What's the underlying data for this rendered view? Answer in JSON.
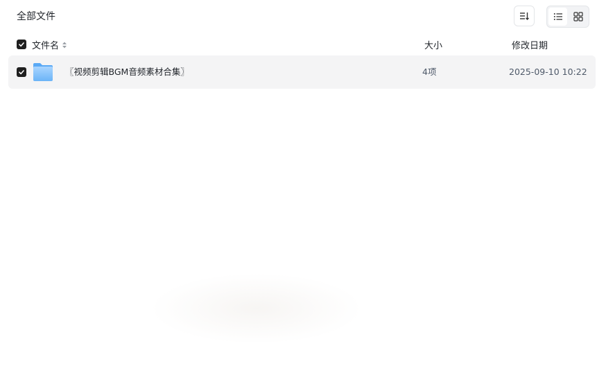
{
  "header": {
    "breadcrumb": "全部文件"
  },
  "toolbar": {
    "sort_icon": "sort-icon",
    "view_list_icon": "list-view-icon",
    "view_grid_icon": "grid-view-icon",
    "active_view": "list"
  },
  "columns": {
    "name": "文件名",
    "size": "大小",
    "modified": "修改日期"
  },
  "files": [
    {
      "name": "〖视频剪辑BGM音频素材合集〗",
      "size": "4项",
      "modified": "2025-09-10 10:22",
      "type": "folder",
      "checked": true
    }
  ],
  "select_all_checked": true,
  "colors": {
    "checkbox": "#1f1f1f",
    "row_bg": "#f4f4f5",
    "folder_light": "#a8d4ff",
    "folder_dark": "#5aa9f5"
  }
}
